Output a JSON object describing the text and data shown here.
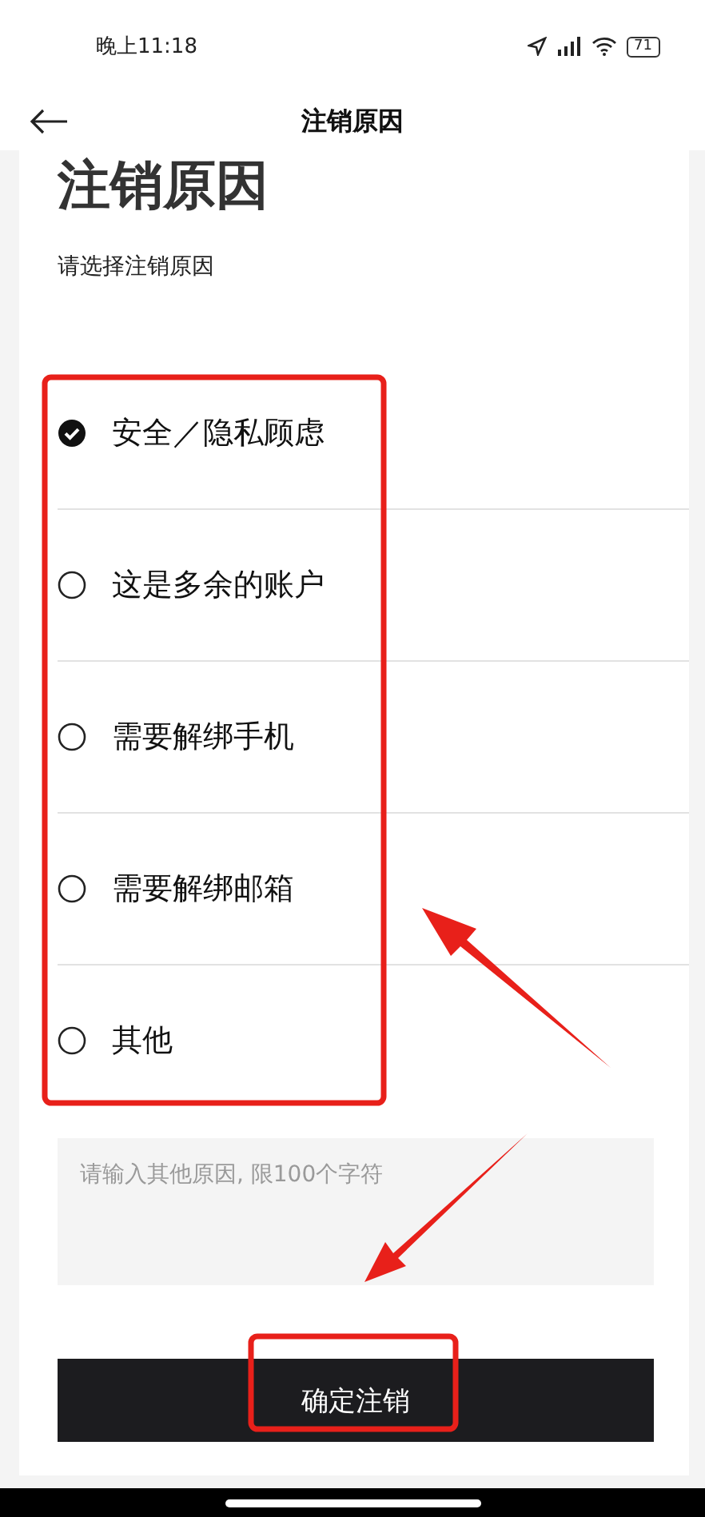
{
  "status_bar": {
    "time": "晚上11:18",
    "battery": "71"
  },
  "header": {
    "title": "注销原因"
  },
  "page": {
    "title": "注销原因",
    "subtitle": "请选择注销原因"
  },
  "reasons": [
    {
      "label": "安全／隐私顾虑",
      "selected": true
    },
    {
      "label": "这是多余的账户",
      "selected": false
    },
    {
      "label": "需要解绑手机",
      "selected": false
    },
    {
      "label": "需要解绑邮箱",
      "selected": false
    },
    {
      "label": "其他",
      "selected": false
    }
  ],
  "other_reason": {
    "placeholder": "请输入其他原因, 限100个字符"
  },
  "confirm_button": {
    "label": "确定注销"
  }
}
